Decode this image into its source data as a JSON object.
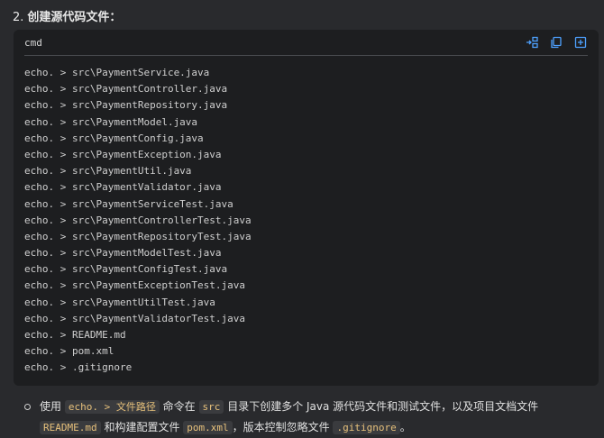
{
  "section": {
    "number": "2.",
    "title": "创建源代码文件："
  },
  "code_block": {
    "language": "cmd",
    "actions": [
      {
        "icon": "insert-icon"
      },
      {
        "icon": "copy-icon"
      },
      {
        "icon": "apply-icon"
      }
    ],
    "lines": [
      "echo. > src\\PaymentService.java",
      "echo. > src\\PaymentController.java",
      "echo. > src\\PaymentRepository.java",
      "echo. > src\\PaymentModel.java",
      "echo. > src\\PaymentConfig.java",
      "echo. > src\\PaymentException.java",
      "echo. > src\\PaymentUtil.java",
      "echo. > src\\PaymentValidator.java",
      "echo. > src\\PaymentServiceTest.java",
      "echo. > src\\PaymentControllerTest.java",
      "echo. > src\\PaymentRepositoryTest.java",
      "echo. > src\\PaymentModelTest.java",
      "echo. > src\\PaymentConfigTest.java",
      "echo. > src\\PaymentExceptionTest.java",
      "echo. > src\\PaymentUtilTest.java",
      "echo. > src\\PaymentValidatorTest.java",
      "echo. > README.md",
      "echo. > pom.xml",
      "echo. > .gitignore"
    ]
  },
  "note": {
    "t1": "使用",
    "c1": "echo. > 文件路径",
    "t2": "命令在",
    "c2": "src",
    "t3": "目录下创建多个 Java 源代码文件和测试文件，以及项目文档文件",
    "c3": "README.md",
    "t4": "和构建配置文件",
    "c4": "pom.xml",
    "t5": "，版本控制忽略文件",
    "c5": ".gitignore",
    "t6": "。"
  }
}
